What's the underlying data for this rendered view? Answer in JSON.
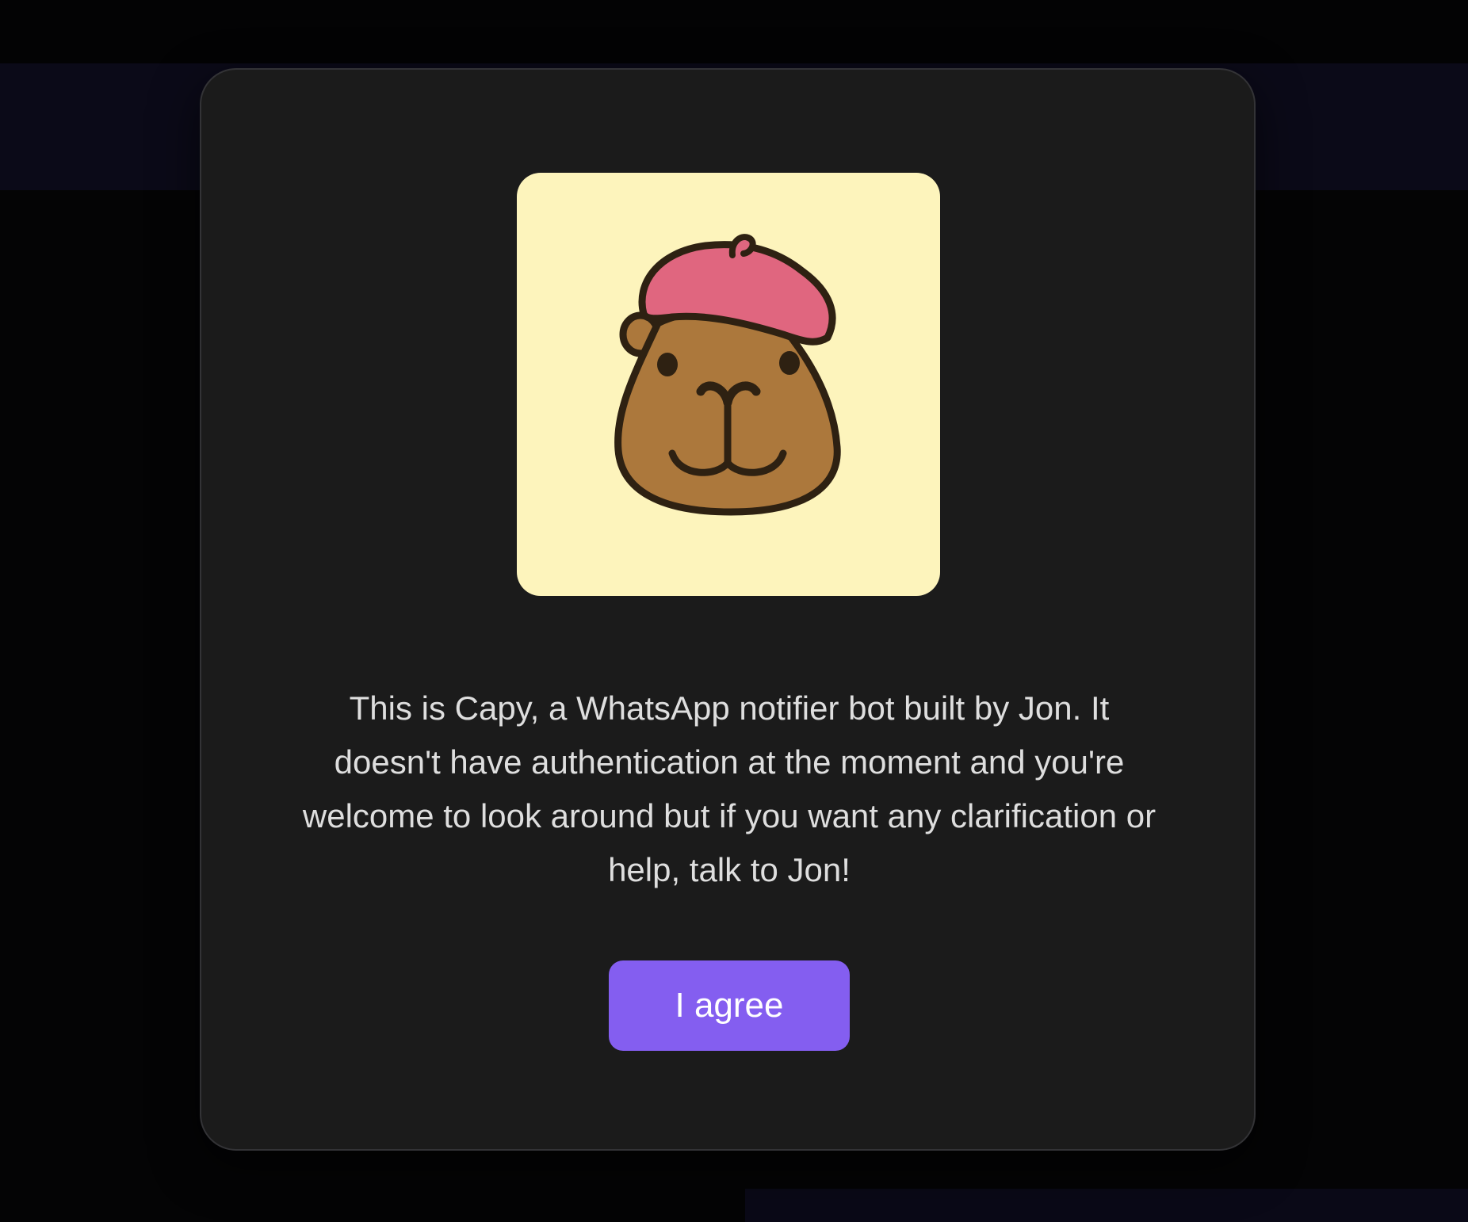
{
  "colors": {
    "page_background": "#050506",
    "modal_background": "#1b1b1b",
    "logo_tile_background": "#fdf4bc",
    "capybara_fur": "#ac783c",
    "beret": "#e0667f",
    "outline": "#2e2112",
    "text": "#dedede",
    "button": "#845ef0",
    "button_text": "#ffffff"
  },
  "modal": {
    "logo_icon": "capybara-with-beret-icon",
    "message": "This is Capy, a WhatsApp notifier bot built by Jon. It doesn't have authentication at the moment and you're welcome to look around but if you want any clarification or help, talk to Jon!",
    "agree_label": "I agree"
  }
}
